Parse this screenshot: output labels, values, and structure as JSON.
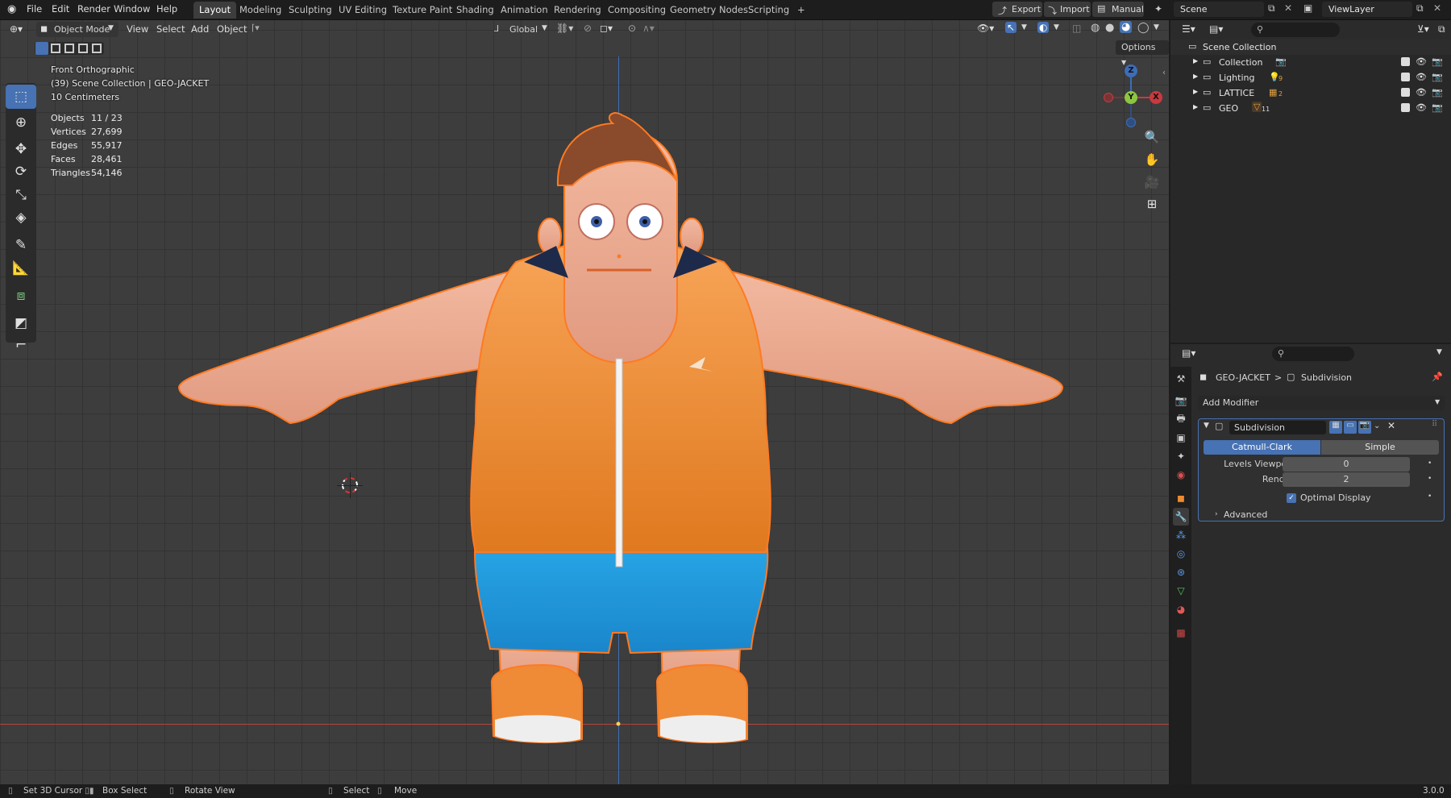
{
  "topbar": {
    "menus": [
      "File",
      "Edit",
      "Render",
      "Window",
      "Help"
    ],
    "workspaces": [
      "Layout",
      "Modeling",
      "Sculpting",
      "UV Editing",
      "Texture Paint",
      "Shading",
      "Animation",
      "Rendering",
      "Compositing",
      "Geometry Nodes",
      "Scripting"
    ],
    "active_workspace": "Layout",
    "add_tab": "+",
    "export": "Export",
    "import": "Import",
    "manual": "Manual",
    "scene": "Scene",
    "view_layer": "ViewLayer"
  },
  "viewport": {
    "mode": "Object Mode",
    "menus": [
      "View",
      "Select",
      "Add",
      "Object"
    ],
    "orientation": "Global",
    "options": "Options",
    "view_name": "Front Orthographic",
    "context": "(39) Scene Collection | GEO-JACKET",
    "scale": "10 Centimeters",
    "stats": [
      {
        "label": "Objects",
        "value": "11 / 23"
      },
      {
        "label": "Vertices",
        "value": "27,699"
      },
      {
        "label": "Edges",
        "value": "55,917"
      },
      {
        "label": "Faces",
        "value": "28,461"
      },
      {
        "label": "Triangles",
        "value": "54,146"
      }
    ],
    "gizmo": {
      "z": "Z",
      "y": "Y",
      "x": "X"
    }
  },
  "outliner": {
    "root": "Scene Collection",
    "items": [
      {
        "label": "Collection",
        "badge": ""
      },
      {
        "label": "Lighting",
        "badge": "9"
      },
      {
        "label": "LATTICE",
        "badge": "2"
      },
      {
        "label": "GEO",
        "badge": "11"
      }
    ]
  },
  "properties": {
    "breadcrumb_object": "GEO-JACKET",
    "breadcrumb_sep": ">",
    "breadcrumb_modifier": "Subdivision",
    "add_modifier": "Add Modifier",
    "modifier_name": "Subdivision",
    "algo_catmull": "Catmull-Clark",
    "algo_simple": "Simple",
    "levels_viewport_label": "Levels Viewport",
    "levels_viewport_value": "0",
    "render_label": "Render",
    "render_value": "2",
    "optimal_display": "Optimal Display",
    "advanced": "Advanced"
  },
  "statusbar": {
    "set_cursor": "Set 3D Cursor",
    "box_select": "Box Select",
    "rotate_view": "Rotate View",
    "select": "Select",
    "move": "Move",
    "version": "3.0.0"
  }
}
